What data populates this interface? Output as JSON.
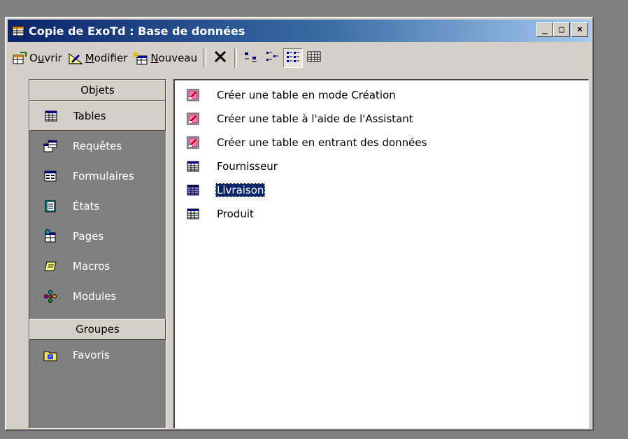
{
  "window": {
    "title": "Copie de ExoTd : Base de données",
    "controls": {
      "minimize": "_",
      "maximize": "□",
      "close": "×"
    }
  },
  "toolbar": {
    "open_prefix": "O",
    "open_underline": "u",
    "open_suffix": "vrir",
    "modify_underline": "M",
    "modify_suffix": "odifier",
    "new_underline": "N",
    "new_suffix": "ouveau",
    "icons": [
      "open-icon",
      "design-icon",
      "new-icon",
      "delete-icon",
      "large-icons-view-icon",
      "small-icons-view-icon",
      "list-view-icon",
      "details-view-icon"
    ]
  },
  "sidebar": {
    "objects_header": "Objets",
    "items": [
      {
        "label": "Tables",
        "icon": "table-icon",
        "active": true
      },
      {
        "label": "Requêtes",
        "icon": "query-icon"
      },
      {
        "label": "Formulaires",
        "icon": "form-icon"
      },
      {
        "label": "États",
        "icon": "report-icon"
      },
      {
        "label": "Pages",
        "icon": "page-icon"
      },
      {
        "label": "Macros",
        "icon": "macro-icon"
      },
      {
        "label": "Modules",
        "icon": "module-icon"
      }
    ],
    "groups_header": "Groupes",
    "groups": [
      {
        "label": "Favoris",
        "icon": "favorites-icon"
      }
    ]
  },
  "list": {
    "items": [
      {
        "label": "Créer une table en mode Création",
        "icon": "create-shortcut-icon"
      },
      {
        "label": "Créer une table à l'aide de l'Assistant",
        "icon": "create-shortcut-icon"
      },
      {
        "label": "Créer une table en entrant des données",
        "icon": "create-shortcut-icon"
      },
      {
        "label": "Fournisseur",
        "icon": "table-icon"
      },
      {
        "label": "Livraison",
        "icon": "table-icon",
        "selected": true
      },
      {
        "label": "Produit",
        "icon": "table-icon"
      }
    ]
  },
  "colors": {
    "title_start": "#0a246a",
    "title_end": "#a6caf0",
    "face": "#d4d0c8",
    "selection": "#0a246a",
    "pane_dark": "#808080"
  }
}
